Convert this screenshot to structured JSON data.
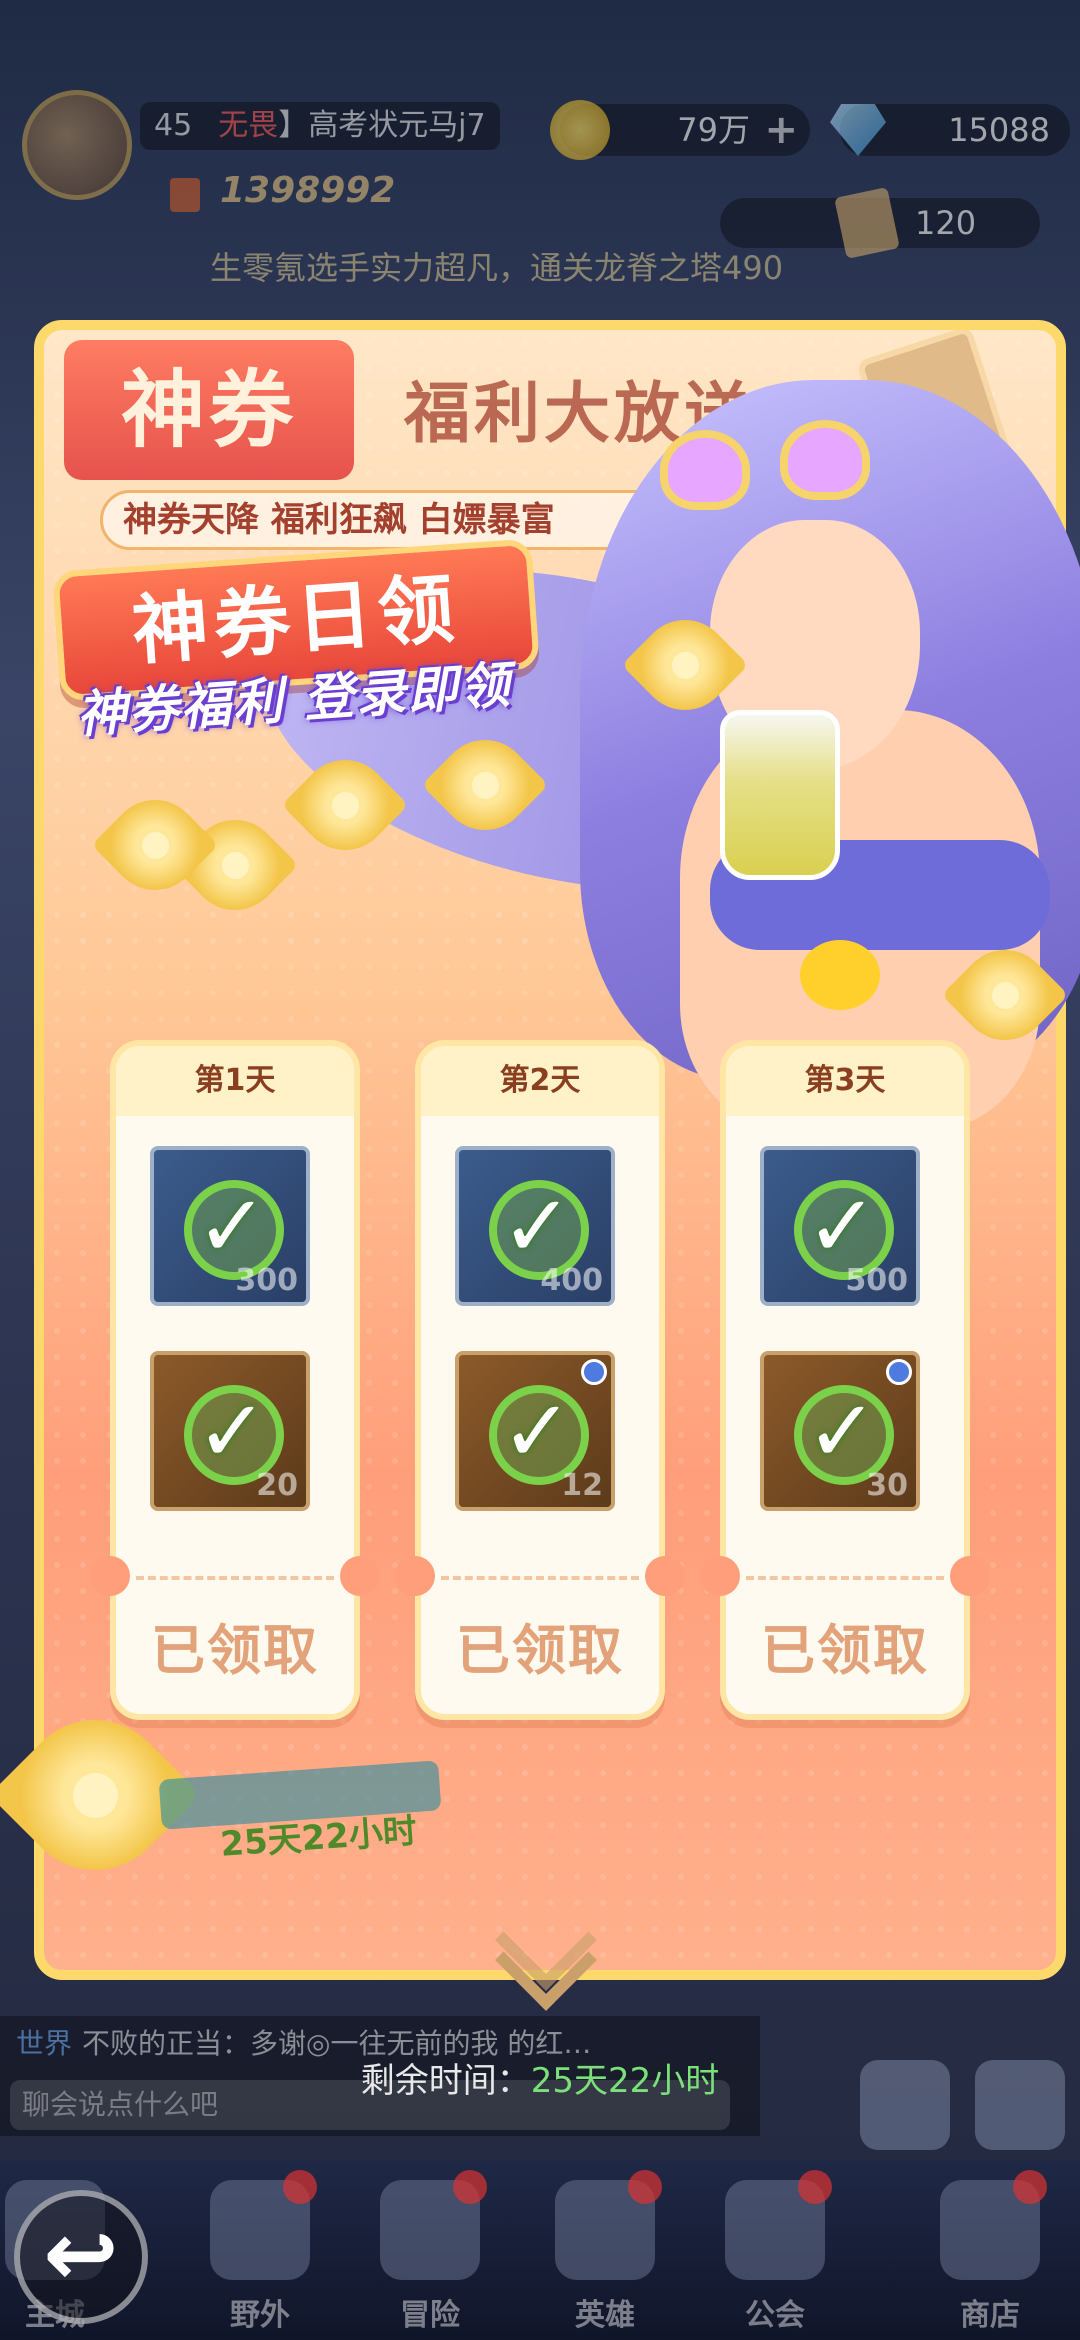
{
  "hud": {
    "level": "45",
    "guild_tag": "无畏",
    "player_name": "高考状元马j7",
    "power": "1398992",
    "gold": "79万",
    "diamonds": "15088",
    "tickets": "120",
    "marquee": "生零氪选手实力超凡，通关龙脊之塔490"
  },
  "panel": {
    "badge": "神券",
    "title": "福利大放送",
    "subtitle": "神券天降 福利狂飙 白嫖暴富",
    "countdown_small": "25天22小时"
  },
  "popup": {
    "title": "神券日领",
    "subtitle": "神券福利 登录即领",
    "cards": [
      {
        "day": "第1天",
        "item1_count": "300",
        "item2_count": "20",
        "status": "已领取"
      },
      {
        "day": "第2天",
        "item1_count": "400",
        "item2_count": "12",
        "status": "已领取"
      },
      {
        "day": "第3天",
        "item1_count": "500",
        "item2_count": "30",
        "status": "已领取"
      }
    ],
    "remain_label": "剩余时间：",
    "remain_value": "25天22小时"
  },
  "chat": {
    "channel": "世界",
    "message": "不败的正当：多谢◎一往无前的我 的红…",
    "input_placeholder": "聊会说点什么吧"
  },
  "nav": [
    {
      "label": "主城"
    },
    {
      "label": "野外"
    },
    {
      "label": "冒险"
    },
    {
      "label": "英雄"
    },
    {
      "label": "公会"
    },
    {
      "label": "商店"
    }
  ],
  "icons": {
    "back": "back-arrow-icon",
    "check": "check-icon",
    "gold": "coin-icon",
    "diamond": "diamond-icon"
  },
  "colors": {
    "accent_red": "#e8473a",
    "claimed_text": "#e2a37a",
    "timer_green": "#7be07a"
  }
}
